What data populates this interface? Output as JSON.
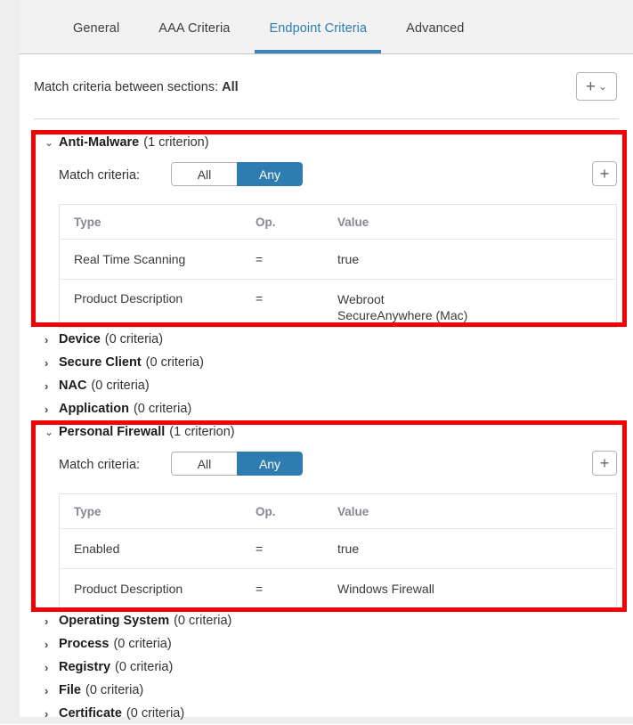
{
  "tabs": [
    {
      "label": "General",
      "active": false
    },
    {
      "label": "AAA Criteria",
      "active": false
    },
    {
      "label": "Endpoint Criteria",
      "active": true
    },
    {
      "label": "Advanced",
      "active": false
    }
  ],
  "toolbar": {
    "match_sections_label": "Match criteria between sections:",
    "match_sections_value": "All",
    "add_dropdown_plus": "+",
    "add_dropdown_chevron": "⌄"
  },
  "table_headers": {
    "type": "Type",
    "op": "Op.",
    "value": "Value"
  },
  "labels": {
    "match_criteria": "Match criteria:",
    "toggle_all": "All",
    "toggle_any": "Any",
    "add_button": "+",
    "caret_expanded": "⌄",
    "caret_collapsed": "›"
  },
  "colors": {
    "accent_blue": "#2e7cb0",
    "tab_active": "#2d7cb5",
    "annotation_red": "#f30000",
    "header_text_gray": "#85888f"
  },
  "sections": [
    {
      "title": "Anti-Malware",
      "count": "(1 criterion)",
      "expanded": true,
      "match": "Any",
      "rows": [
        {
          "type": "Real Time Scanning",
          "op": "=",
          "value": "true"
        },
        {
          "type": "Product Description",
          "op": "=",
          "value": "Webroot SecureAnywhere (Mac)"
        }
      ]
    },
    {
      "title": "Device",
      "count": "(0 criteria)",
      "expanded": false
    },
    {
      "title": "Secure Client",
      "count": "(0 criteria)",
      "expanded": false
    },
    {
      "title": "NAC",
      "count": "(0 criteria)",
      "expanded": false
    },
    {
      "title": "Application",
      "count": "(0 criteria)",
      "expanded": false
    },
    {
      "title": "Personal Firewall",
      "count": "(1 criterion)",
      "expanded": true,
      "match": "Any",
      "rows": [
        {
          "type": "Enabled",
          "op": "=",
          "value": "true"
        },
        {
          "type": "Product Description",
          "op": "=",
          "value": "Windows Firewall"
        }
      ]
    },
    {
      "title": "Operating System",
      "count": "(0 criteria)",
      "expanded": false
    },
    {
      "title": "Process",
      "count": "(0 criteria)",
      "expanded": false
    },
    {
      "title": "Registry",
      "count": "(0 criteria)",
      "expanded": false
    },
    {
      "title": "File",
      "count": "(0 criteria)",
      "expanded": false
    },
    {
      "title": "Certificate",
      "count": "(0 criteria)",
      "expanded": false
    }
  ]
}
